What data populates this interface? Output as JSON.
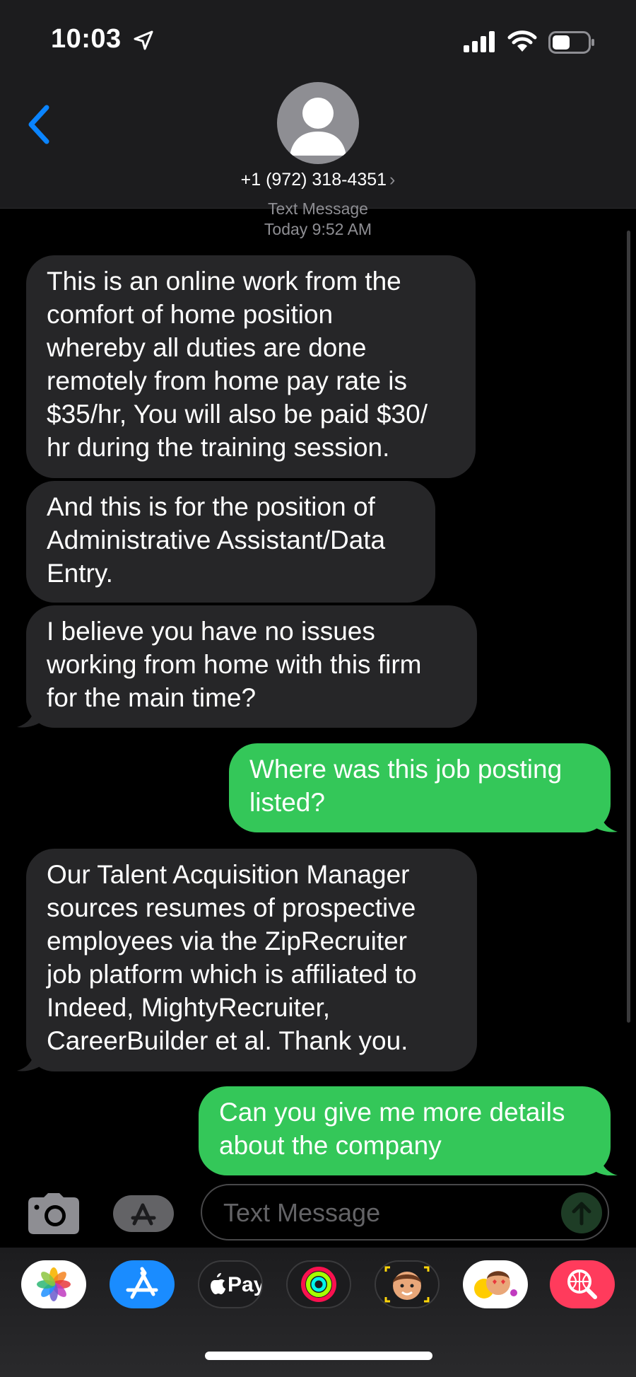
{
  "status_bar": {
    "time": "10:03",
    "battery_level": 0.5
  },
  "header": {
    "contact_number": "+1 (972) 318-4351",
    "chevron": "›"
  },
  "thread": {
    "service_label": "Text Message",
    "timestamp": "Today 9:52 AM",
    "messages": [
      {
        "direction": "incoming",
        "text": "This is an online work from the\ncomfort of home position\nwhereby all duties are done\nremotely from home pay rate is\n$35/hr, You will also be paid $30/\nhr during the training session."
      },
      {
        "direction": "incoming",
        "text": "And this is for the position of\nAdministrative Assistant/Data\nEntry."
      },
      {
        "direction": "incoming",
        "text": "I believe you have no issues\nworking from home with this firm\nfor the main time?"
      },
      {
        "direction": "outgoing",
        "text": "Where was this job posting\nlisted?"
      },
      {
        "direction": "incoming",
        "text": "Our Talent Acquisition Manager\nsources resumes of prospective\nemployees via the ZipRecruiter\n job platform which is affiliated to\nIndeed, MightyRecruiter,\nCareerBuilder et al. Thank you."
      },
      {
        "direction": "outgoing",
        "text": "Can you give me more details\nabout the company"
      }
    ]
  },
  "compose": {
    "placeholder": "Text Message"
  },
  "app_drawer": {
    "items": [
      {
        "name": "photos-app-icon"
      },
      {
        "name": "app-store-icon"
      },
      {
        "name": "apple-pay-icon",
        "label": "Pay"
      },
      {
        "name": "activity-icon"
      },
      {
        "name": "memoji-icon"
      },
      {
        "name": "memoji-stickers-icon"
      },
      {
        "name": "image-search-icon"
      }
    ]
  },
  "colors": {
    "incoming_bubble": "#262628",
    "outgoing_bubble": "#34c759",
    "accent": "#0a84ff",
    "background": "#000000",
    "bar_background": "#1c1c1e"
  }
}
